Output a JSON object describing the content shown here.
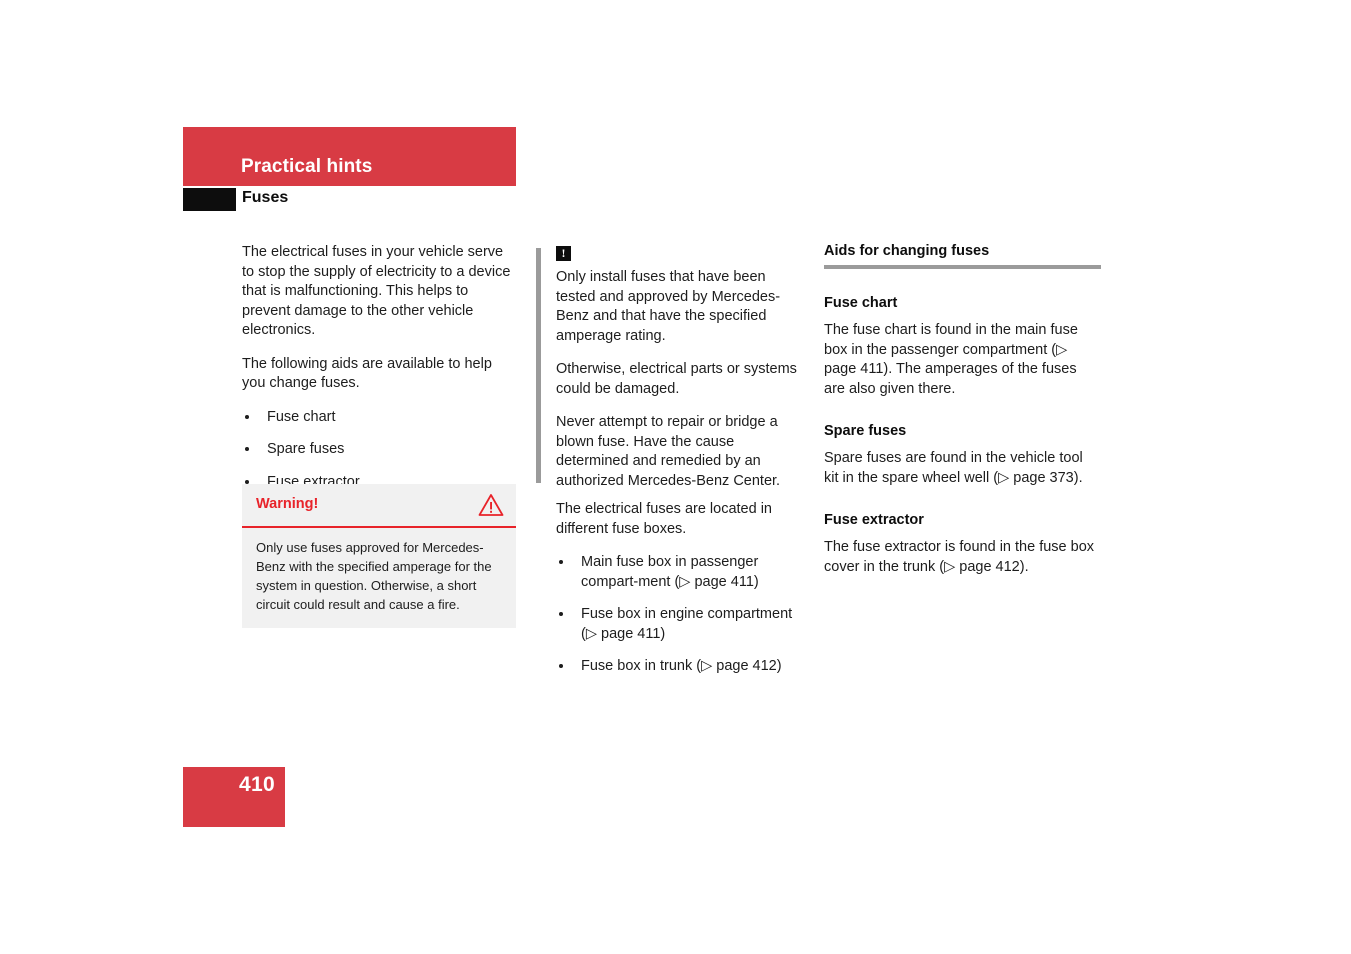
{
  "colors": {
    "brand_red": "#d83b44",
    "warning_red": "#e8232a",
    "note_gray": "#9b9b9b",
    "warning_bg": "#f1f1f1",
    "black": "#0d0d0d"
  },
  "header": {
    "band_title": "Practical hints",
    "subtitle": "Fuses"
  },
  "column1": {
    "paragraphs": [
      "The electrical fuses in your vehicle serve to stop the supply of electricity to a device that is malfunctioning. This helps to prevent damage to the other vehicle electronics.",
      "The following aids are available to help you change fuses."
    ],
    "bullets": [
      "Fuse chart",
      "Spare fuses",
      "Fuse extractor"
    ],
    "warning": {
      "title": "Warning!",
      "icon": "warning-triangle-icon",
      "body": "Only use fuses approved for Mercedes-Benz with the specified amperage for the system in question. Otherwise, a short circuit could result and cause a fire."
    }
  },
  "column2": {
    "note": {
      "icon": "exclamation-box-icon",
      "icon_glyph": "!",
      "paragraphs": [
        "Only install fuses that have been tested and approved by Mercedes-Benz and that have the specified amperage rating.",
        "Otherwise, electrical parts or systems could be damaged.",
        "Never attempt to repair or bridge a blown fuse. Have the cause determined and remedied by an authorized Mercedes-Benz Center."
      ]
    },
    "intro": "The electrical fuses are located in different fuse boxes.",
    "bullets": [
      "Main fuse box in passenger compart-ment (▷ page 411)",
      "Fuse box in engine compartment (▷ page 411)",
      "Fuse box in trunk (▷ page 412)"
    ]
  },
  "column3": {
    "section_title": "Aids for changing fuses",
    "subsections": [
      {
        "heading": "Fuse chart",
        "body": "The fuse chart is found in the main fuse box in the passenger compartment (▷ page 411). The amperages of the fuses are also given there."
      },
      {
        "heading": "Spare fuses",
        "body": "Spare fuses are found in the vehicle tool kit in the spare wheel well (▷ page 373)."
      },
      {
        "heading": "Fuse extractor",
        "body": "The fuse extractor is found in the fuse box cover in the trunk (▷ page 412)."
      }
    ]
  },
  "footer": {
    "page_number": "410"
  }
}
